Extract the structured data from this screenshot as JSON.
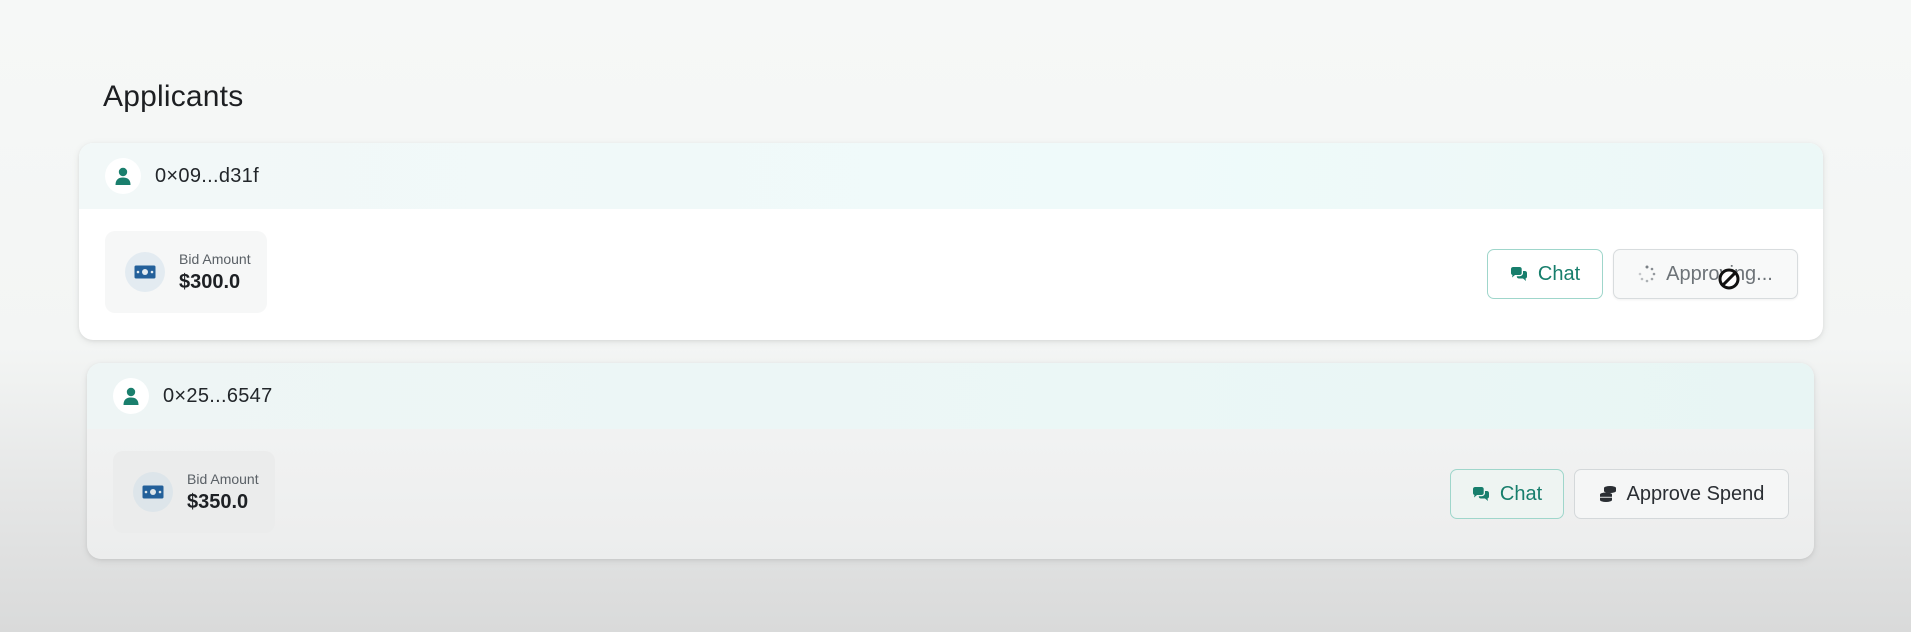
{
  "page": {
    "title": "Applicants"
  },
  "applicants": [
    {
      "address": "0×09...d31f",
      "bid_label": "Bid Amount",
      "bid_value": "$300.0",
      "chat_label": "Chat",
      "action_label": "Approving..."
    },
    {
      "address": "0×25...6547",
      "bid_label": "Bid Amount",
      "bid_value": "$350.0",
      "chat_label": "Chat",
      "action_label": "Approve Spend"
    }
  ],
  "icons": {
    "avatar": "user-icon",
    "bid": "money-bill-icon",
    "chat": "comments-icon",
    "loading": "spinner-icon",
    "approve": "coins-icon"
  },
  "colors": {
    "accent": "#177e6c",
    "chat_border": "#9fd6cb",
    "header_tint": "#effafa"
  }
}
